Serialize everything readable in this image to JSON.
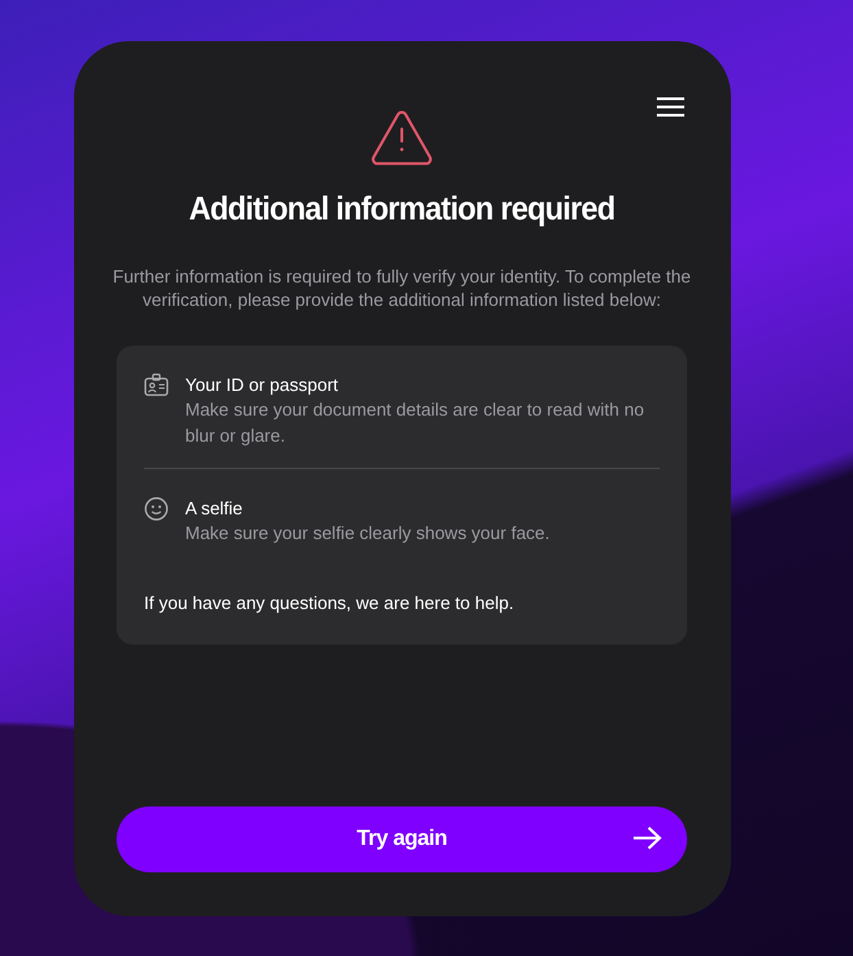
{
  "title": "Additional information required",
  "description": "Further information is required to fully verify your identity. To complete the verification, please provide the additional information listed below:",
  "requirements": [
    {
      "kind": "id",
      "title": "Your ID or passport",
      "detail": "Make sure your document details are clear to read with no blur or glare."
    },
    {
      "kind": "selfie",
      "title": "A selfie",
      "detail": "Make sure your selfie clearly shows your face."
    }
  ],
  "help_text": "If you have any questions, we are here to help.",
  "primary_button": {
    "label": "Try again"
  }
}
